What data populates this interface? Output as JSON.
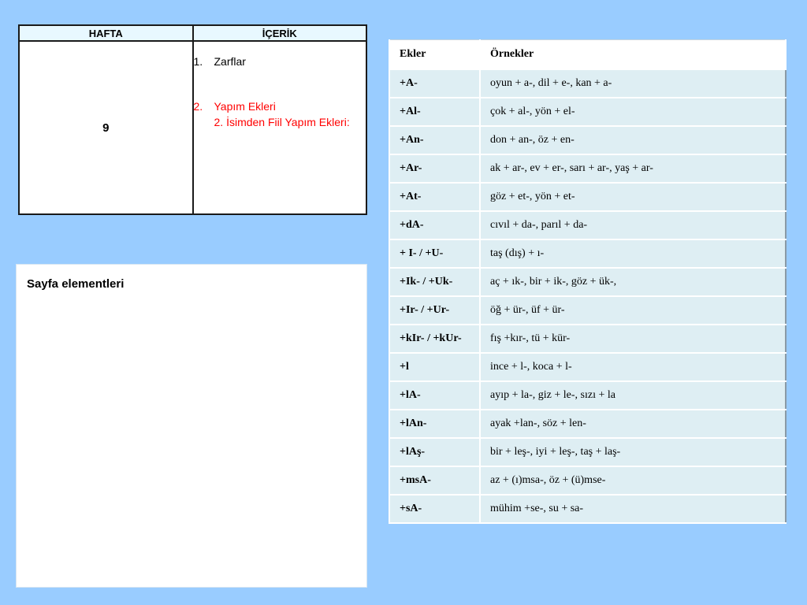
{
  "week_table": {
    "header_week": "HAFTA",
    "header_content": "İÇERİK",
    "week": "9",
    "items": [
      {
        "num": "1.",
        "text": "Zarflar",
        "color": "#000000"
      },
      {
        "num": "2.",
        "text": "Yapım Ekleri",
        "color": "#ff0000"
      },
      {
        "num": "",
        "text": "2. İsimden Fiil Yapım Ekleri:",
        "color": "#ff0000"
      }
    ]
  },
  "page_elements": {
    "title": "Sayfa elementleri"
  },
  "suffix_table": {
    "headers": [
      "Ekler",
      "Örnekler"
    ],
    "rows": [
      {
        "suffix": "+A-",
        "examples": "oyun + a-, dil + e-, kan + a-"
      },
      {
        "suffix": "+Al-",
        "examples": "çok + al-, yön + el-"
      },
      {
        "suffix": "+An-",
        "examples": "don + an-, öz + en-"
      },
      {
        "suffix": "+Ar-",
        "examples": "ak + ar-, ev + er-, sarı + ar-, yaş + ar-"
      },
      {
        "suffix": "+At-",
        "examples": "göz + et-, yön + et-"
      },
      {
        "suffix": "+dA-",
        "examples": "cıvıl + da-, parıl + da-"
      },
      {
        "suffix": "+ I- / +U-",
        "examples": "taş (dış) + ı-"
      },
      {
        "suffix": "+Ik- / +Uk-",
        "examples": "aç + ık-, bir + ik-, göz + ük-,"
      },
      {
        "suffix": "+Ir- / +Ur-",
        "examples": "öğ + ür-, üf + ür-"
      },
      {
        "suffix": "+kIr- / +kUr-",
        "examples": "fış +kır-, tü + kür-"
      },
      {
        "suffix": "+l",
        "examples": "ince + l-, koca + l-"
      },
      {
        "suffix": "+lA-",
        "examples": "ayıp + la-, giz + le-, sızı + la"
      },
      {
        "suffix": "+lAn-",
        "examples": "ayak +lan-, söz + len-"
      },
      {
        "suffix": "+lAş-",
        "examples": "bir + leş-, iyi + leş-, taş + laş-"
      },
      {
        "suffix": "+msA-",
        "examples": "az + (ı)msa-, öz + (ü)mse-"
      },
      {
        "suffix": "+sA-",
        "examples": "mühim +se-, su + sa-"
      }
    ]
  }
}
